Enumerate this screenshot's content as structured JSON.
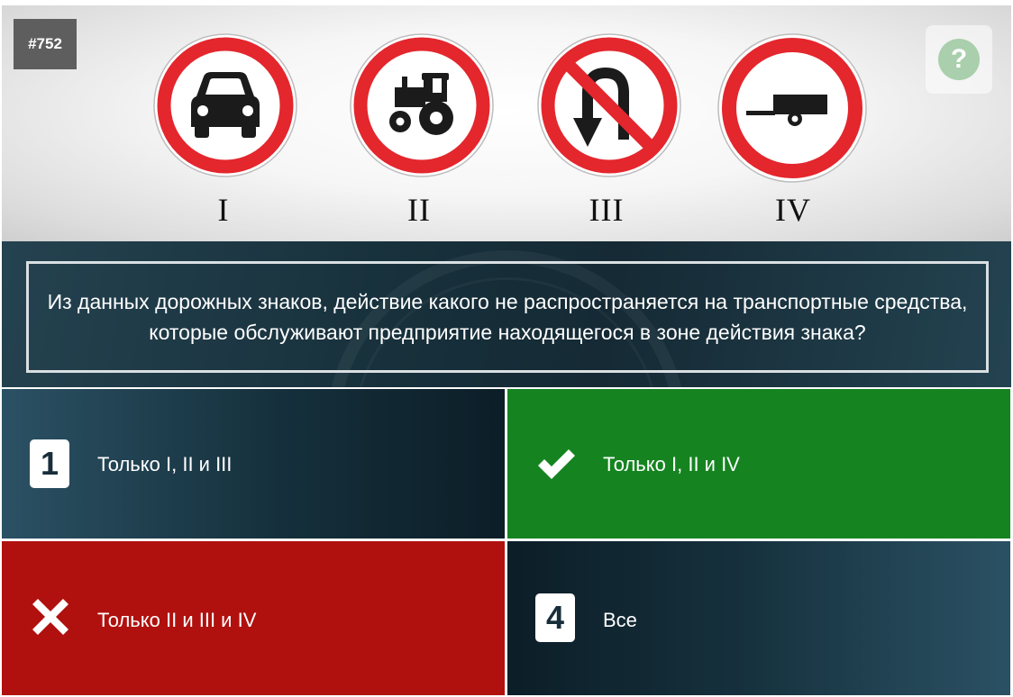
{
  "question_number": "#752",
  "help": {
    "icon": "question-circle-icon",
    "symbol": "?"
  },
  "signs": [
    {
      "label": "I",
      "icon": "no-motor-vehicles-sign-icon"
    },
    {
      "label": "II",
      "icon": "no-tractors-sign-icon"
    },
    {
      "label": "III",
      "icon": "no-u-turn-sign-icon"
    },
    {
      "label": "IV",
      "icon": "no-trailer-sign-icon"
    }
  ],
  "question": "Из данных дорожных знаков, действие какого не распространяется на транспортные средства, которые обслуживают предприятие находящегося в зоне действия знака?",
  "answers": [
    {
      "badge": "1",
      "text": "Только I, II и III",
      "state": "neutral"
    },
    {
      "badge": "",
      "icon": "checkmark-icon",
      "text": "Только I, II и IV",
      "state": "correct"
    },
    {
      "badge": "",
      "icon": "cross-icon",
      "text": "Только II и III и IV",
      "state": "wrong"
    },
    {
      "badge": "4",
      "text": "Все",
      "state": "neutral"
    }
  ],
  "colors": {
    "correct": "#158420",
    "wrong": "#b0110e",
    "neutral": "#15303c",
    "sign_red": "#e4262d"
  }
}
